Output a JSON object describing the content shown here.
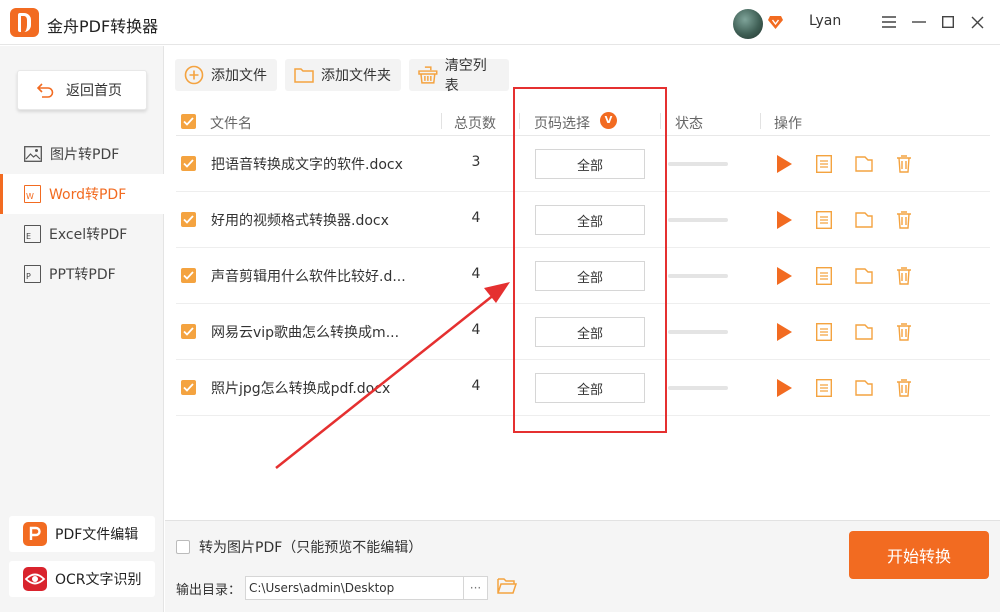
{
  "app": {
    "title": "金舟PDF转换器",
    "username": "Lyan"
  },
  "sidebar": {
    "back_label": "返回首页",
    "items": [
      {
        "label": "图片转PDF",
        "icon": "image-icon"
      },
      {
        "label": "Word转PDF",
        "icon": "word-doc-icon",
        "active": true
      },
      {
        "label": "Excel转PDF",
        "icon": "excel-doc-icon"
      },
      {
        "label": "PPT转PDF",
        "icon": "ppt-doc-icon"
      }
    ],
    "tools": [
      {
        "label": "PDF文件编辑",
        "icon": "pdf-edit-icon"
      },
      {
        "label": "OCR文字识别",
        "icon": "ocr-eye-icon"
      }
    ]
  },
  "toolbar": {
    "add_file": "添加文件",
    "add_folder": "添加文件夹",
    "clear_list": "清空列表"
  },
  "table": {
    "headers": {
      "filename": "文件名",
      "pages": "总页数",
      "page_select": "页码选择",
      "status": "状态",
      "actions": "操作"
    },
    "page_select_badge": "V",
    "rows": [
      {
        "name": "把语音转换成文字的软件.docx",
        "pages": "3",
        "range": "全部",
        "checked": true,
        "progress": 0
      },
      {
        "name": "好用的视频格式转换器.docx",
        "pages": "4",
        "range": "全部",
        "checked": true,
        "progress": 0
      },
      {
        "name": "声音剪辑用什么软件比较好.d...",
        "pages": "4",
        "range": "全部",
        "checked": true,
        "progress": 0
      },
      {
        "name": "网易云vip歌曲怎么转换成m...",
        "pages": "4",
        "range": "全部",
        "checked": true,
        "progress": 0
      },
      {
        "name": "照片jpg怎么转换成pdf.docx",
        "pages": "4",
        "range": "全部",
        "checked": true,
        "progress": 0
      }
    ]
  },
  "bottom": {
    "to_image_pdf_label": "转为图片PDF（只能预览不能编辑）",
    "output_label": "输出目录：",
    "output_path": "C:\\Users\\admin\\Desktop",
    "more_label": "···",
    "start_label": "开始转换"
  },
  "colors": {
    "accent": "#f26b21",
    "checkbox": "#f4a340",
    "annotation_red": "#e53030",
    "sidebar_bg": "#f5f5f5"
  }
}
